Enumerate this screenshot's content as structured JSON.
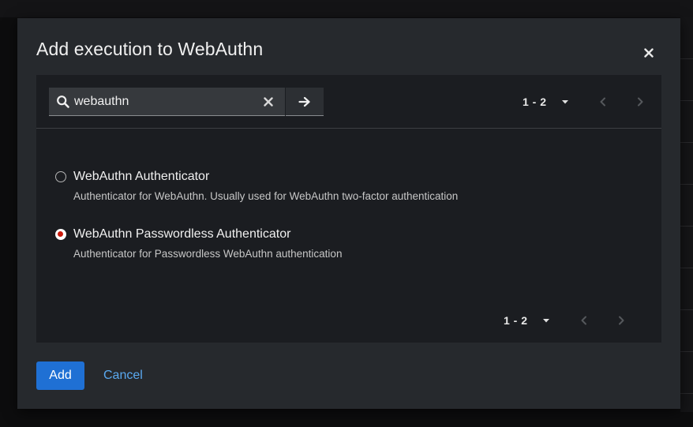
{
  "modal": {
    "title": "Add execution to WebAuthn"
  },
  "search": {
    "value": "webauthn",
    "placeholder": ""
  },
  "pagination_top": {
    "range": "1 - 2"
  },
  "pagination_bottom": {
    "range": "1 - 2"
  },
  "options": [
    {
      "label": "WebAuthn Authenticator",
      "description": "Authenticator for WebAuthn. Usually used for WebAuthn two-factor authentication",
      "selected": false
    },
    {
      "label": "WebAuthn Passwordless Authenticator",
      "description": "Authenticator for Passwordless WebAuthn authentication",
      "selected": true
    }
  ],
  "actions": {
    "add_label": "Add",
    "cancel_label": "Cancel"
  },
  "icons": {
    "search": "search-icon",
    "clear": "times-icon",
    "go": "arrow-right-icon",
    "close": "close-icon",
    "caret": "caret-down-icon",
    "prev": "chevron-left-icon",
    "next": "chevron-right-icon"
  },
  "colors": {
    "modal_bg": "#26292d",
    "panel_bg": "#1b1d21",
    "primary": "#1f70d4",
    "link": "#5aa9f0",
    "radio_selected": "#c9190b"
  }
}
